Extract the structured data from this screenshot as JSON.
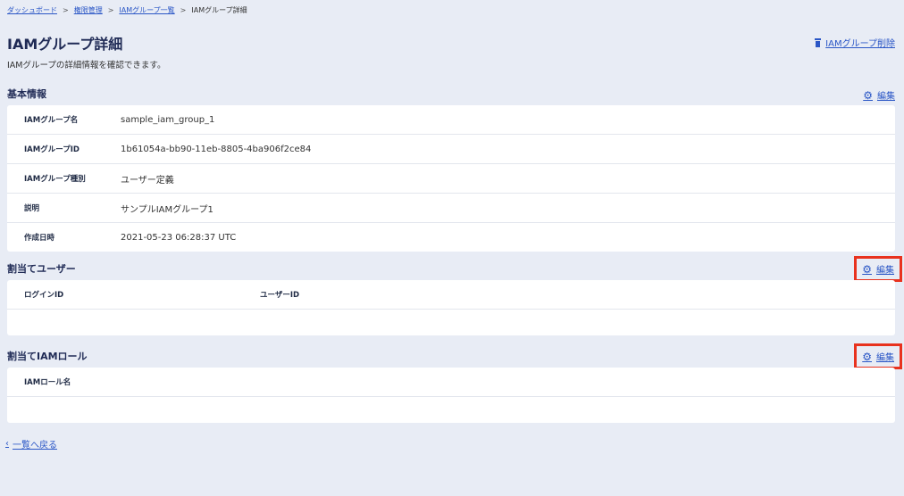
{
  "breadcrumb": {
    "items": [
      "ダッシュボード",
      "権限管理",
      "IAMグループ一覧"
    ],
    "current": "IAMグループ詳細",
    "separator": ">"
  },
  "header": {
    "title": "IAMグループ詳細",
    "description": "IAMグループの詳細情報を確認できます。",
    "delete_label": "IAMグループ削除"
  },
  "basic_info": {
    "title": "基本情報",
    "edit_label": "編集",
    "rows": [
      {
        "label": "IAMグループ名",
        "value": "sample_iam_group_1"
      },
      {
        "label": "IAMグループID",
        "value": "1b61054a-bb90-11eb-8805-4ba906f2ce84"
      },
      {
        "label": "IAMグループ種別",
        "value": "ユーザー定義"
      },
      {
        "label": "説明",
        "value": "サンプルIAMグループ1"
      },
      {
        "label": "作成日時",
        "value": "2021-05-23 06:28:37 UTC"
      }
    ]
  },
  "assigned_users": {
    "title": "割当てユーザー",
    "edit_label": "編集",
    "columns": [
      "ログインID",
      "ユーザーID"
    ]
  },
  "assigned_roles": {
    "title": "割当てIAMロール",
    "edit_label": "編集",
    "columns": [
      "IAMロール名"
    ]
  },
  "footer": {
    "back_label": "一覧へ戻る",
    "back_chevron": "‹"
  },
  "colors": {
    "background": "#e8ecf5",
    "link": "#2a56c6",
    "highlight": "#e8321e",
    "title": "#1f2a55"
  },
  "icons": {
    "delete": "trash-icon",
    "edit": "gear-icon",
    "back": "chevron-left-icon"
  }
}
